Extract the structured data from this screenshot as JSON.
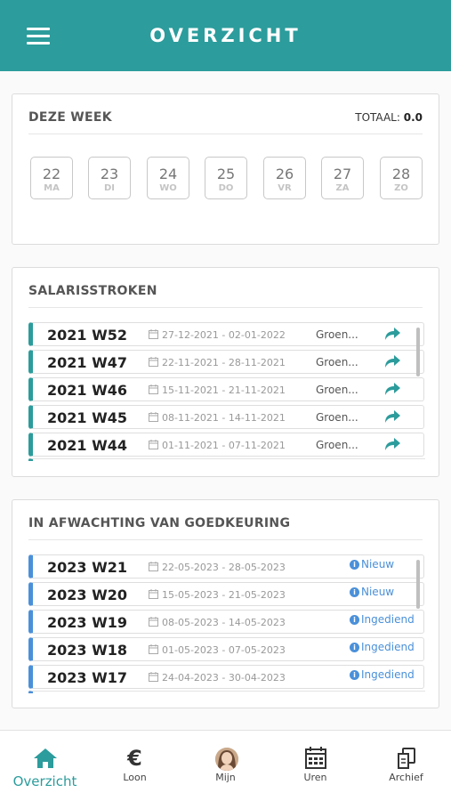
{
  "header": {
    "title": "OVERZICHT",
    "menu_icon": "hamburger-menu-icon"
  },
  "week": {
    "title": "DEZE WEEK",
    "total_label": "TOTAAL:",
    "total_value": "0.0",
    "days": [
      {
        "num": "22",
        "name": "MA"
      },
      {
        "num": "23",
        "name": "DI"
      },
      {
        "num": "24",
        "name": "WO"
      },
      {
        "num": "25",
        "name": "DO"
      },
      {
        "num": "26",
        "name": "VR"
      },
      {
        "num": "27",
        "name": "ZA"
      },
      {
        "num": "28",
        "name": "ZO"
      }
    ]
  },
  "salary": {
    "title": "SALARISSTROKEN",
    "accent": "#2c9c9c",
    "rows": [
      {
        "week": "2021 W52",
        "dates": "27-12-2021 - 02-01-2022",
        "status": "Groen..."
      },
      {
        "week": "2021 W47",
        "dates": "22-11-2021 - 28-11-2021",
        "status": "Groen..."
      },
      {
        "week": "2021 W46",
        "dates": "15-11-2021 - 21-11-2021",
        "status": "Groen..."
      },
      {
        "week": "2021 W45",
        "dates": "08-11-2021 - 14-11-2021",
        "status": "Groen..."
      },
      {
        "week": "2021 W44",
        "dates": "01-11-2021 - 07-11-2021",
        "status": "Groen..."
      }
    ]
  },
  "pending": {
    "title": "IN AFWACHTING VAN GOEDKEURING",
    "accent": "#4a90d9",
    "rows": [
      {
        "week": "2023 W21",
        "dates": "22-05-2023 - 28-05-2023",
        "status": "Nieuw"
      },
      {
        "week": "2023 W20",
        "dates": "15-05-2023 - 21-05-2023",
        "status": "Nieuw"
      },
      {
        "week": "2023 W19",
        "dates": "08-05-2023 - 14-05-2023",
        "status": "Ingediend"
      },
      {
        "week": "2023 W18",
        "dates": "01-05-2023 - 07-05-2023",
        "status": "Ingediend"
      },
      {
        "week": "2023 W17",
        "dates": "24-04-2023 - 30-04-2023",
        "status": "Ingediend"
      }
    ]
  },
  "tabs": [
    {
      "label": "Overzicht",
      "icon": "home-icon",
      "active": true
    },
    {
      "label": "Loon",
      "icon": "euro-icon",
      "glyph": "€"
    },
    {
      "label": "Mijn",
      "icon": "avatar-icon"
    },
    {
      "label": "Uren",
      "icon": "calendar-icon"
    },
    {
      "label": "Archief",
      "icon": "archive-icon"
    }
  ]
}
